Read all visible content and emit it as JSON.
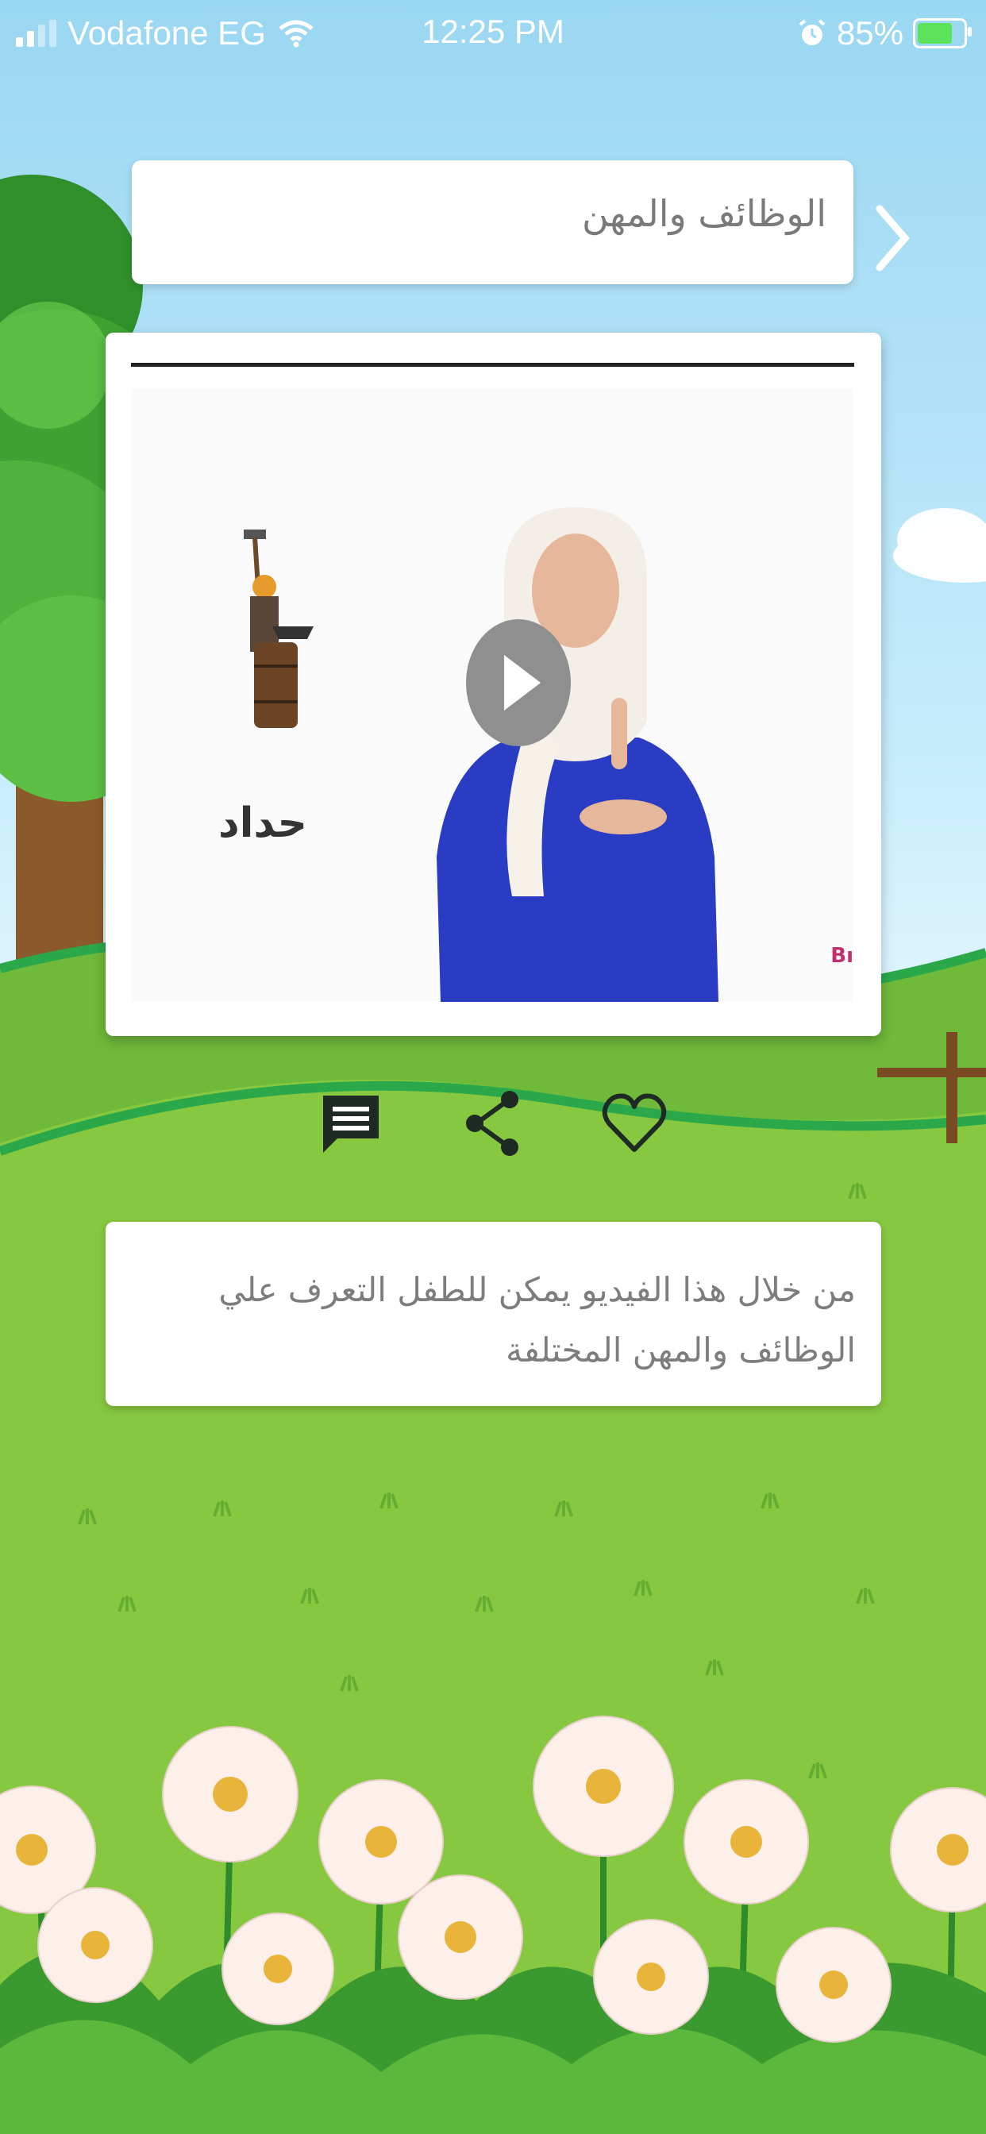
{
  "status_bar": {
    "carrier": "Vodafone EG",
    "time": "12:25 PM",
    "battery": "85%",
    "battery_level": 0.85,
    "icons": [
      "signal-icon",
      "wifi-icon",
      "alarm-icon",
      "battery-charging-icon"
    ]
  },
  "header": {
    "title": "الوظائف والمهن",
    "next_icon": "chevron-right-icon"
  },
  "video": {
    "thumbnail_word": "حداد",
    "thumbnail_brand_partial": "Bı",
    "play_icon": "play-icon"
  },
  "actions": {
    "comment_icon": "comment-icon",
    "share_icon": "share-icon",
    "favorite_icon": "heart-icon"
  },
  "description": {
    "text": "من خلال هذا الفيديو يمكن للطفل التعرف علي الوظائف والمهن المختلفة"
  },
  "colors": {
    "sky": "#9ad7f2",
    "grass": "#7cc23a",
    "card": "#ffffff",
    "title_text": "#7a7a7a"
  }
}
